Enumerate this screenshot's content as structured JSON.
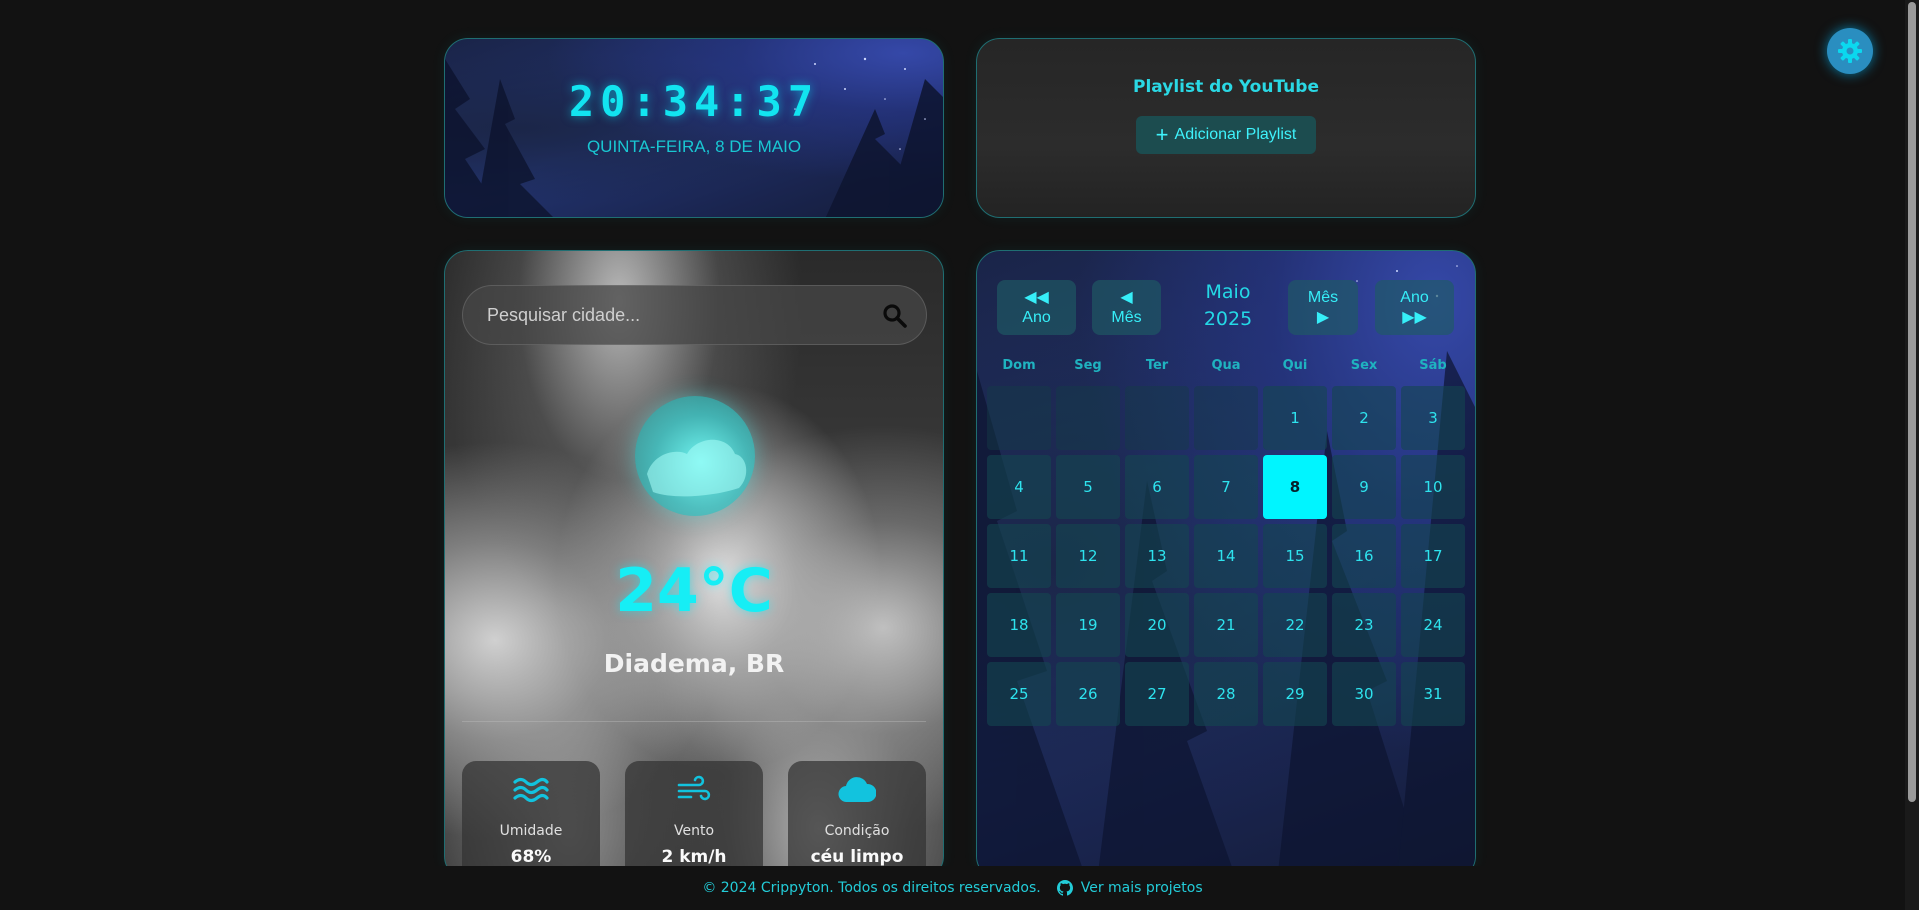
{
  "clock": {
    "time": "20:34:37",
    "date": "QUINTA-FEIRA, 8 DE MAIO"
  },
  "playlist": {
    "title": "Playlist do YouTube",
    "button_label": "Adicionar Playlist",
    "button_icon": "plus-icon"
  },
  "weather": {
    "search_placeholder": "Pesquisar cidade...",
    "search_icon": "search-icon",
    "condition_icon": "cloud-sun-icon",
    "temperature": "24°C",
    "city": "Diadema, BR",
    "stats": [
      {
        "icon": "water-waves-icon",
        "label": "Umidade",
        "value": "68%"
      },
      {
        "icon": "wind-icon",
        "label": "Vento",
        "value": "2 km/h"
      },
      {
        "icon": "cloud-icon",
        "label": "Condição",
        "value": "céu limpo"
      }
    ]
  },
  "calendar": {
    "prev_year": {
      "arrow": "◀◀",
      "label": "Ano"
    },
    "prev_month": {
      "arrow": "◀",
      "label": "Mês"
    },
    "next_month": {
      "arrow": "▶",
      "label": "Mês"
    },
    "next_year": {
      "arrow": "▶▶",
      "label": "Ano"
    },
    "month": "Maio",
    "year": "2025",
    "weekdays": [
      "Dom",
      "Seg",
      "Ter",
      "Qua",
      "Qui",
      "Sex",
      "Sáb"
    ],
    "first_weekday_index": 4,
    "days_in_month": 31,
    "today": 8
  },
  "settings": {
    "icon": "gear-icon"
  },
  "footer": {
    "copyright": "© 2024 Crippyton. Todos os direitos reservados.",
    "link_label": "Ver mais projetos",
    "link_icon": "github-icon"
  },
  "colors": {
    "accent": "#00f5ff",
    "background": "#121212",
    "border": "#1f6e72"
  }
}
